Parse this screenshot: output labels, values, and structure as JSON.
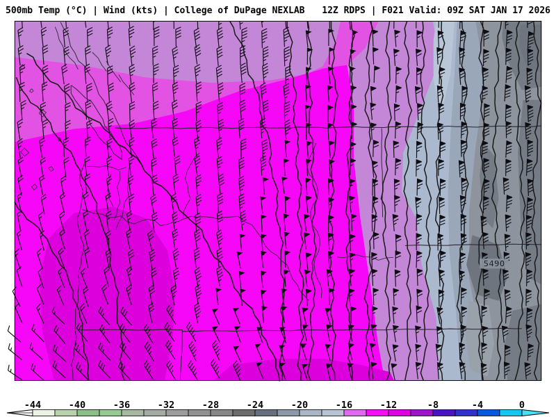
{
  "header": {
    "left": "500mb Temp (°C) | Wind (kts) | College of DuPage NEXLAB",
    "right": "12Z RDPS | F021 Valid: 09Z SAT JAN 17 2026"
  },
  "map": {
    "contour_label": "5490",
    "colors": {
      "orchid_band": "#c487d8",
      "medium_magenta": "#e353e3",
      "bright_magenta": "#f707f7",
      "deep_magenta": "#dc00dc",
      "light_blue_band": "#aab9cd",
      "lighter_blue_patch": "#b9c6d8",
      "slate_blue": "#9aa7b8",
      "gray_region": "#8d949d",
      "mid_gray_patch": "#757c85",
      "dark_gray_patch": "#6e757e",
      "light_gray_patch": "#99a1ab",
      "contour_line": "#1a1a1a",
      "geo_line": "#2a2330",
      "barb": "#0d0d12"
    }
  },
  "wind": {
    "unit": "kts",
    "regime": "northerly",
    "speed_min_kts": 15,
    "speed_max_kts": 90
  },
  "colorbar": {
    "unit": "°C",
    "tick_step": 4,
    "segment_step": 2,
    "ticks": [
      -44,
      -40,
      -36,
      -32,
      -28,
      -24,
      -20,
      -16,
      -12,
      -8,
      -4,
      0
    ],
    "segments": [
      {
        "from": -44,
        "to": -42,
        "color": "#ecf2e6"
      },
      {
        "from": -42,
        "to": -40,
        "color": "#b6d3aa"
      },
      {
        "from": -40,
        "to": -38,
        "color": "#8abf85"
      },
      {
        "from": -38,
        "to": -36,
        "color": "#95ca91"
      },
      {
        "from": -36,
        "to": -34,
        "color": "#a8b7a0"
      },
      {
        "from": -34,
        "to": -32,
        "color": "#a5aba3"
      },
      {
        "from": -32,
        "to": -30,
        "color": "#9c9c9c"
      },
      {
        "from": -30,
        "to": -28,
        "color": "#929292"
      },
      {
        "from": -28,
        "to": -26,
        "color": "#868686"
      },
      {
        "from": -26,
        "to": -24,
        "color": "#6c6c6c"
      },
      {
        "from": -24,
        "to": -22,
        "color": "#667081"
      },
      {
        "from": -22,
        "to": -20,
        "color": "#8c99aa"
      },
      {
        "from": -20,
        "to": -18,
        "color": "#a9b6c8"
      },
      {
        "from": -18,
        "to": -16,
        "color": "#b7c4d6"
      },
      {
        "from": -16,
        "to": -14,
        "color": "#d96ee8"
      },
      {
        "from": -14,
        "to": -12,
        "color": "#f80df8"
      },
      {
        "from": -12,
        "to": -10,
        "color": "#e100e6"
      },
      {
        "from": -10,
        "to": -8,
        "color": "#9915cf"
      },
      {
        "from": -8,
        "to": -6,
        "color": "#4813c7"
      },
      {
        "from": -6,
        "to": -4,
        "color": "#3030d0"
      },
      {
        "from": -4,
        "to": -2,
        "color": "#0b57e3"
      },
      {
        "from": -2,
        "to": 0,
        "color": "#12c9ea"
      }
    ],
    "left_overflow_color": "#ffffff",
    "right_overflow_color": "#49dff2"
  }
}
